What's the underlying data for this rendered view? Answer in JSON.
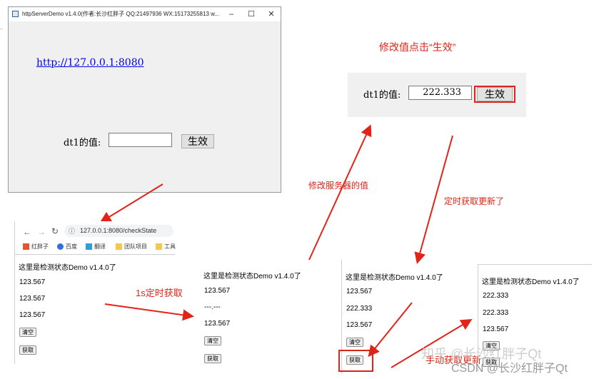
{
  "window": {
    "title": "httpServerDemo v1.4.0(作者:长沙红胖子 QQ:21497936 WX:15173255813 w...",
    "minimize": "–",
    "maximize": "☐",
    "close": "✕",
    "link": "http://127.0.0.1:8080",
    "dt1_label": "dt1的值:",
    "dt1_value": "",
    "apply_label": "生效"
  },
  "zoom_panel": {
    "dt1_label": "dt1的值:",
    "dt1_value": "222.333",
    "apply_label": "生效"
  },
  "annotations": {
    "modify_click": "修改值点击“生效”",
    "modify_server": "修改服务器的值",
    "timer_refresh": "定时获取更新了",
    "timer_1s": "1s定时获取",
    "manual_fetch": "手动获取更新"
  },
  "browser": {
    "url": "127.0.0.1:8080/checkState",
    "bookmarks": [
      "红胖子",
      "百度",
      "翻译",
      "团队项目",
      "工具"
    ]
  },
  "pages": [
    {
      "heading": "这里是检测状态Demo v1.4.0了",
      "values": [
        "123.567",
        "123.567",
        "123.567"
      ],
      "clear": "清空",
      "fetch": "获取"
    },
    {
      "heading": "这里是检测状态Demo v1.4.0了",
      "values": [
        "123.567",
        "---.---",
        "123.567"
      ],
      "clear": "清空",
      "fetch": "获取"
    },
    {
      "heading": "这里是检测状态Demo v1.4.0了",
      "values": [
        "123.567",
        "222.333",
        "123.567"
      ],
      "clear": "清空",
      "fetch": "获取"
    },
    {
      "heading": "这里是检测状态Demo v1.4.0了",
      "values": [
        "222.333",
        "222.333",
        "123.567"
      ],
      "clear": "清空",
      "fetch": "获取"
    }
  ],
  "watermarks": {
    "zhihu": "知乎 @长沙红胖子Qt",
    "csdn": "CSDN @长沙红胖子Qt"
  },
  "colors": {
    "annotation": "#e2231a",
    "link": "#0000ee"
  }
}
